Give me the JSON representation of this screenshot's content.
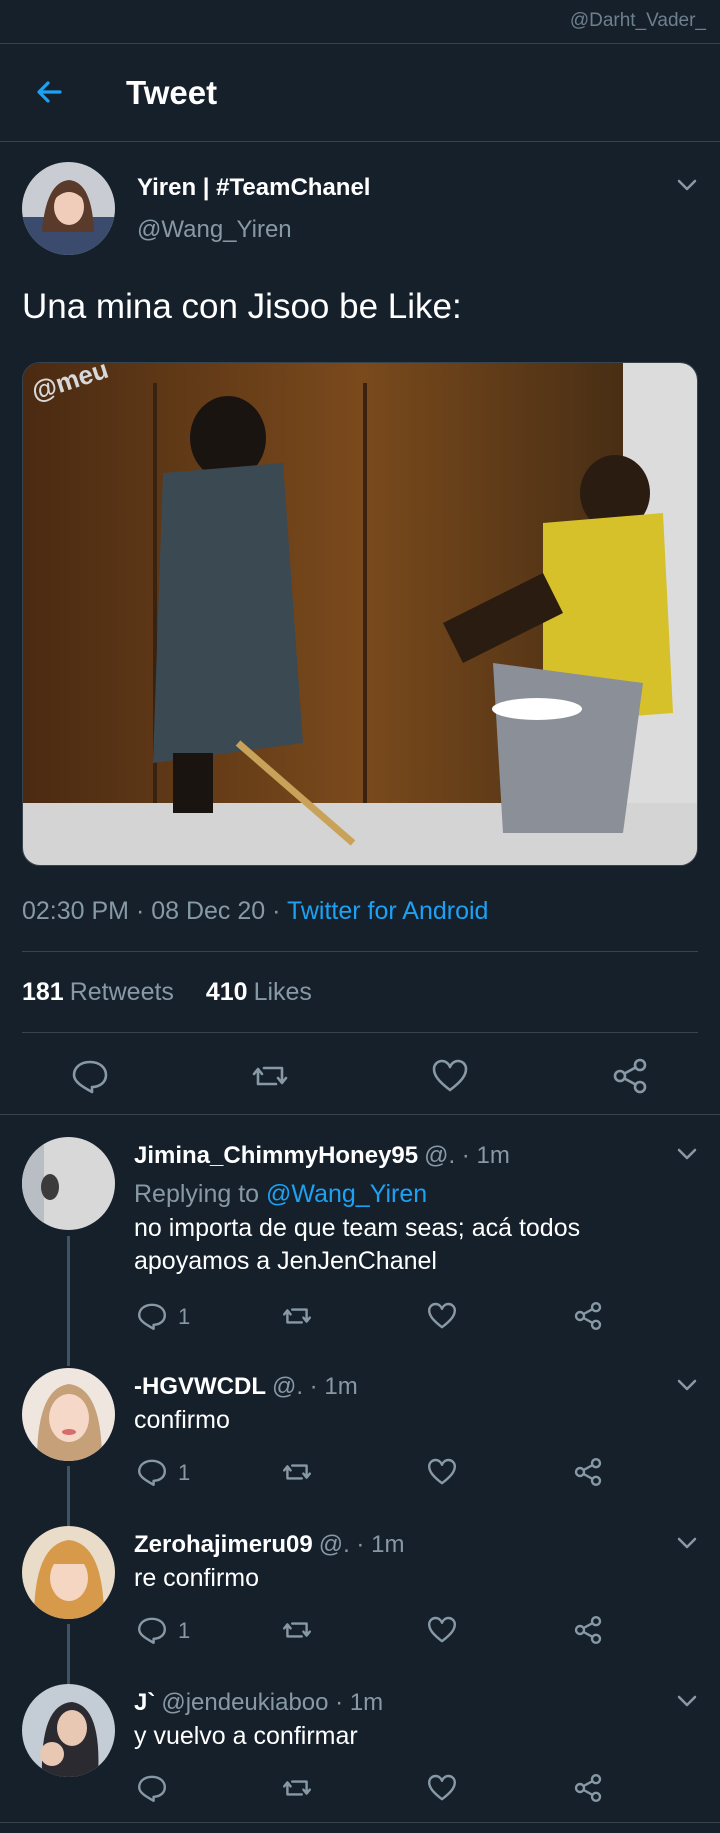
{
  "watermark": "@Darht_Vader_",
  "header": {
    "title": "Tweet"
  },
  "tweet": {
    "author_name": "Yiren | #TeamChanel",
    "author_handle": "@Wang_Yiren",
    "text": "Una mina con Jisoo be Like:",
    "image_watermark": "@meu",
    "time": "02:30 PM · 08 Dec 20 · ",
    "source": "Twitter for Android",
    "retweets_count": "181",
    "retweets_label": "Retweets",
    "likes_count": "410",
    "likes_label": "Likes"
  },
  "replies": [
    {
      "name": "Jimina_ChimmyHoney95",
      "meta": "@. · 1m",
      "replying_prefix": "Replying to ",
      "replying_handle": "@Wang_Yiren",
      "line1": "no importa de que team seas; acá todos",
      "line2": "apoyamos a JenJenChanel",
      "reply_count": "1"
    },
    {
      "name": "-HGVWCDL",
      "meta": "@. · 1m",
      "line1": "confirmo",
      "reply_count": "1"
    },
    {
      "name": "Zerohajimeru09",
      "meta": "@. · 1m",
      "line1": "re confirmo",
      "reply_count": "1"
    },
    {
      "name": "J`",
      "meta": "@jendeukiaboo · 1m",
      "line1": "y vuelvo a confirmar",
      "reply_count": ""
    }
  ],
  "colors": {
    "background": "#15202b",
    "accent": "#1da1f2",
    "muted": "#8899a6",
    "divider": "#38444d"
  }
}
